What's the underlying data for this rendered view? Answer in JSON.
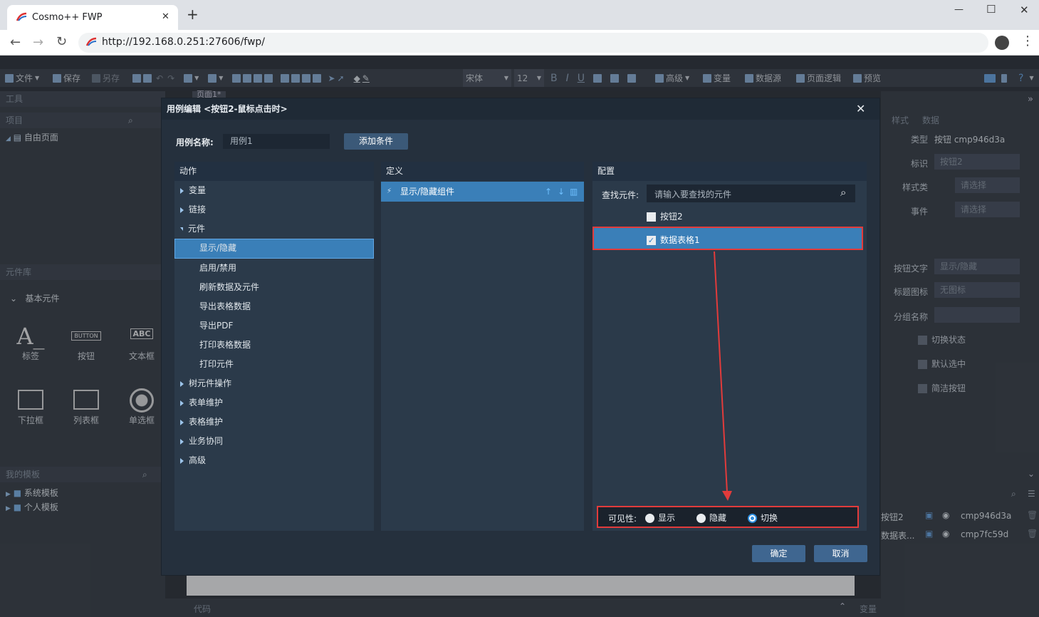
{
  "browser": {
    "tab_title": "Cosmo++ FWP",
    "url": "http://192.168.0.251:27606/fwp/",
    "new_tab": "+",
    "win_min": "—",
    "win_max": "☐",
    "win_close": "✕"
  },
  "toolbar": {
    "file": "文件",
    "save": "保存",
    "save_as": "另存",
    "font_name": "宋体",
    "font_size": "12",
    "advanced": "高级",
    "variable": "变量",
    "datasource": "数据源",
    "page_logic": "页面逻辑",
    "preview": "预览"
  },
  "left_panel": {
    "tools": "工具",
    "project": "项目",
    "free_page": "自由页面",
    "library": "元件库",
    "basic": "基本元件",
    "components": [
      {
        "label": "标签",
        "icon": "A_"
      },
      {
        "label": "按钮",
        "icon": "BUTTON"
      },
      {
        "label": "文本框",
        "icon": "ABC"
      },
      {
        "label": "下拉框",
        "icon": ""
      },
      {
        "label": "列表框",
        "icon": ""
      },
      {
        "label": "单选框",
        "icon": ""
      }
    ],
    "my_templates": "我的模板",
    "system_templates": "系统模板",
    "personal_templates": "个人模板"
  },
  "canvas": {
    "page_tab": "页面1*",
    "code": "代码"
  },
  "right_panel": {
    "tab_style": "样式",
    "tab_data": "数据",
    "type_label": "类型",
    "type_value": "按钮 cmp946d3a",
    "id_label": "标识",
    "id_value": "按钮2",
    "style_label": "样式类",
    "style_value": "请选择",
    "event_label": "事件",
    "event_value": "请选择",
    "btn_text_label": "按钮文字",
    "btn_text_value": "显示/隐藏",
    "title_icon_label": "标题图标",
    "title_icon_value": "无图标",
    "group_label": "分组名称",
    "toggle_state": "切换状态",
    "default_selected": "默认选中",
    "simple_button": "简洁按钮",
    "layer_rows": [
      {
        "name": "按钮2",
        "id": "cmp946d3a"
      },
      {
        "name": "数据表...",
        "id": "cmp7fc59d"
      }
    ],
    "variables": "变量"
  },
  "modal": {
    "title": "用例编辑 <按钮2-鼠标点击时>",
    "case_name_label": "用例名称:",
    "case_name_value": "用例1",
    "add_condition": "添加条件",
    "actions_header": "动作",
    "definition_header": "定义",
    "config_header": "配置",
    "actions": [
      {
        "label": "变量",
        "open": false
      },
      {
        "label": "链接",
        "open": false
      },
      {
        "label": "元件",
        "open": true
      }
    ],
    "sub_actions": [
      "显示/隐藏",
      "启用/禁用",
      "刷新数据及元件",
      "导出表格数据",
      "导出PDF",
      "打印表格数据",
      "打印元件"
    ],
    "actions_more": [
      "树元件操作",
      "表单维护",
      "表格维护",
      "业务协同",
      "高级"
    ],
    "definition_item": "显示/隐藏组件",
    "find_label": "查找元件:",
    "find_placeholder": "请输入要查找的元件",
    "component_items": [
      {
        "label": "按钮2",
        "checked": false
      },
      {
        "label": "数据表格1",
        "checked": true
      }
    ],
    "visibility_label": "可见性:",
    "visibility_options": [
      "显示",
      "隐藏",
      "切换"
    ],
    "visibility_selected": "切换",
    "ok": "确定",
    "cancel": "取消",
    "close": "✕"
  },
  "colors": {
    "highlight_red": "#e23b3b",
    "selected_blue": "#3a7fb8",
    "modal_bg": "#25303d"
  }
}
